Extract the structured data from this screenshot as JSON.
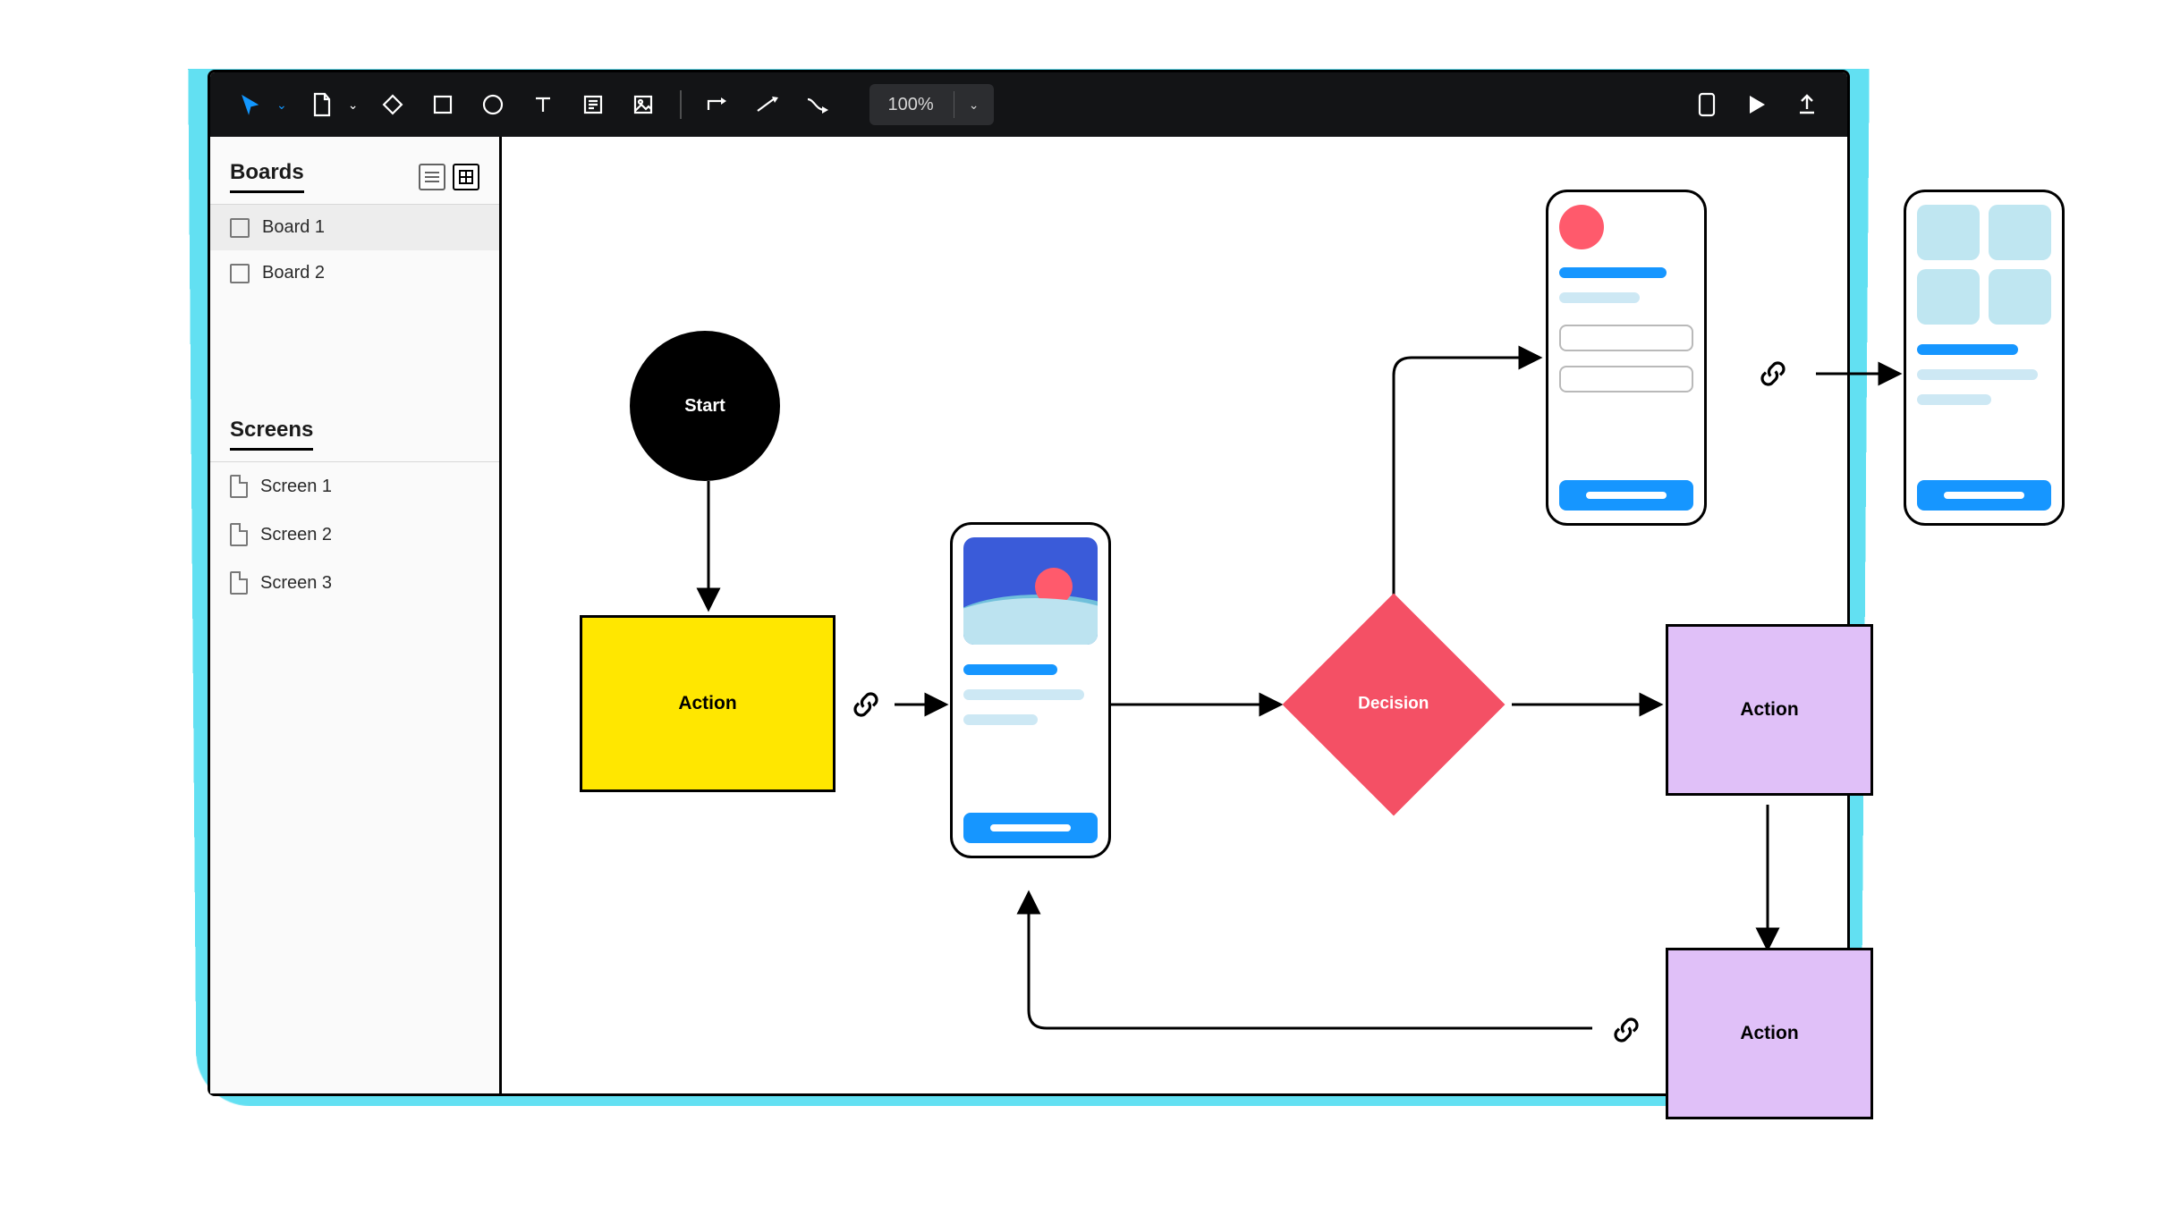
{
  "toolbar": {
    "zoom": "100%"
  },
  "sidebar": {
    "boards_title": "Boards",
    "boards": [
      "Board 1",
      "Board 2"
    ],
    "screens_title": "Screens",
    "screens": [
      "Screen 1",
      "Screen 2",
      "Screen 3"
    ]
  },
  "diagram": {
    "start": "Start",
    "action_yellow": "Action",
    "decision": "Decision",
    "action_purple_1": "Action",
    "action_purple_2": "Action"
  }
}
